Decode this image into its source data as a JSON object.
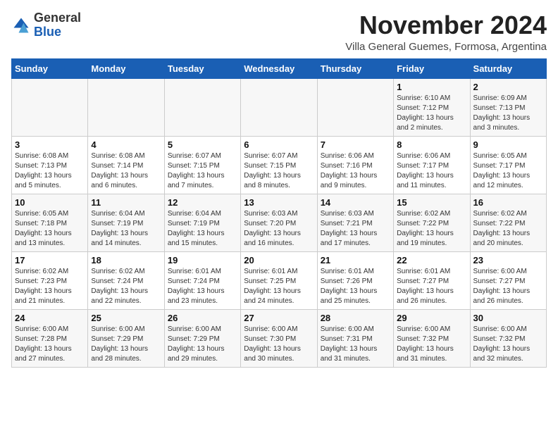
{
  "logo": {
    "general": "General",
    "blue": "Blue"
  },
  "title": {
    "month": "November 2024",
    "location": "Villa General Guemes, Formosa, Argentina"
  },
  "weekdays": [
    "Sunday",
    "Monday",
    "Tuesday",
    "Wednesday",
    "Thursday",
    "Friday",
    "Saturday"
  ],
  "weeks": [
    [
      {
        "day": "",
        "info": ""
      },
      {
        "day": "",
        "info": ""
      },
      {
        "day": "",
        "info": ""
      },
      {
        "day": "",
        "info": ""
      },
      {
        "day": "",
        "info": ""
      },
      {
        "day": "1",
        "info": "Sunrise: 6:10 AM\nSunset: 7:12 PM\nDaylight: 13 hours and 2 minutes."
      },
      {
        "day": "2",
        "info": "Sunrise: 6:09 AM\nSunset: 7:13 PM\nDaylight: 13 hours and 3 minutes."
      }
    ],
    [
      {
        "day": "3",
        "info": "Sunrise: 6:08 AM\nSunset: 7:13 PM\nDaylight: 13 hours and 5 minutes."
      },
      {
        "day": "4",
        "info": "Sunrise: 6:08 AM\nSunset: 7:14 PM\nDaylight: 13 hours and 6 minutes."
      },
      {
        "day": "5",
        "info": "Sunrise: 6:07 AM\nSunset: 7:15 PM\nDaylight: 13 hours and 7 minutes."
      },
      {
        "day": "6",
        "info": "Sunrise: 6:07 AM\nSunset: 7:15 PM\nDaylight: 13 hours and 8 minutes."
      },
      {
        "day": "7",
        "info": "Sunrise: 6:06 AM\nSunset: 7:16 PM\nDaylight: 13 hours and 9 minutes."
      },
      {
        "day": "8",
        "info": "Sunrise: 6:06 AM\nSunset: 7:17 PM\nDaylight: 13 hours and 11 minutes."
      },
      {
        "day": "9",
        "info": "Sunrise: 6:05 AM\nSunset: 7:17 PM\nDaylight: 13 hours and 12 minutes."
      }
    ],
    [
      {
        "day": "10",
        "info": "Sunrise: 6:05 AM\nSunset: 7:18 PM\nDaylight: 13 hours and 13 minutes."
      },
      {
        "day": "11",
        "info": "Sunrise: 6:04 AM\nSunset: 7:19 PM\nDaylight: 13 hours and 14 minutes."
      },
      {
        "day": "12",
        "info": "Sunrise: 6:04 AM\nSunset: 7:19 PM\nDaylight: 13 hours and 15 minutes."
      },
      {
        "day": "13",
        "info": "Sunrise: 6:03 AM\nSunset: 7:20 PM\nDaylight: 13 hours and 16 minutes."
      },
      {
        "day": "14",
        "info": "Sunrise: 6:03 AM\nSunset: 7:21 PM\nDaylight: 13 hours and 17 minutes."
      },
      {
        "day": "15",
        "info": "Sunrise: 6:02 AM\nSunset: 7:22 PM\nDaylight: 13 hours and 19 minutes."
      },
      {
        "day": "16",
        "info": "Sunrise: 6:02 AM\nSunset: 7:22 PM\nDaylight: 13 hours and 20 minutes."
      }
    ],
    [
      {
        "day": "17",
        "info": "Sunrise: 6:02 AM\nSunset: 7:23 PM\nDaylight: 13 hours and 21 minutes."
      },
      {
        "day": "18",
        "info": "Sunrise: 6:02 AM\nSunset: 7:24 PM\nDaylight: 13 hours and 22 minutes."
      },
      {
        "day": "19",
        "info": "Sunrise: 6:01 AM\nSunset: 7:24 PM\nDaylight: 13 hours and 23 minutes."
      },
      {
        "day": "20",
        "info": "Sunrise: 6:01 AM\nSunset: 7:25 PM\nDaylight: 13 hours and 24 minutes."
      },
      {
        "day": "21",
        "info": "Sunrise: 6:01 AM\nSunset: 7:26 PM\nDaylight: 13 hours and 25 minutes."
      },
      {
        "day": "22",
        "info": "Sunrise: 6:01 AM\nSunset: 7:27 PM\nDaylight: 13 hours and 26 minutes."
      },
      {
        "day": "23",
        "info": "Sunrise: 6:00 AM\nSunset: 7:27 PM\nDaylight: 13 hours and 26 minutes."
      }
    ],
    [
      {
        "day": "24",
        "info": "Sunrise: 6:00 AM\nSunset: 7:28 PM\nDaylight: 13 hours and 27 minutes."
      },
      {
        "day": "25",
        "info": "Sunrise: 6:00 AM\nSunset: 7:29 PM\nDaylight: 13 hours and 28 minutes."
      },
      {
        "day": "26",
        "info": "Sunrise: 6:00 AM\nSunset: 7:29 PM\nDaylight: 13 hours and 29 minutes."
      },
      {
        "day": "27",
        "info": "Sunrise: 6:00 AM\nSunset: 7:30 PM\nDaylight: 13 hours and 30 minutes."
      },
      {
        "day": "28",
        "info": "Sunrise: 6:00 AM\nSunset: 7:31 PM\nDaylight: 13 hours and 31 minutes."
      },
      {
        "day": "29",
        "info": "Sunrise: 6:00 AM\nSunset: 7:32 PM\nDaylight: 13 hours and 31 minutes."
      },
      {
        "day": "30",
        "info": "Sunrise: 6:00 AM\nSunset: 7:32 PM\nDaylight: 13 hours and 32 minutes."
      }
    ]
  ]
}
